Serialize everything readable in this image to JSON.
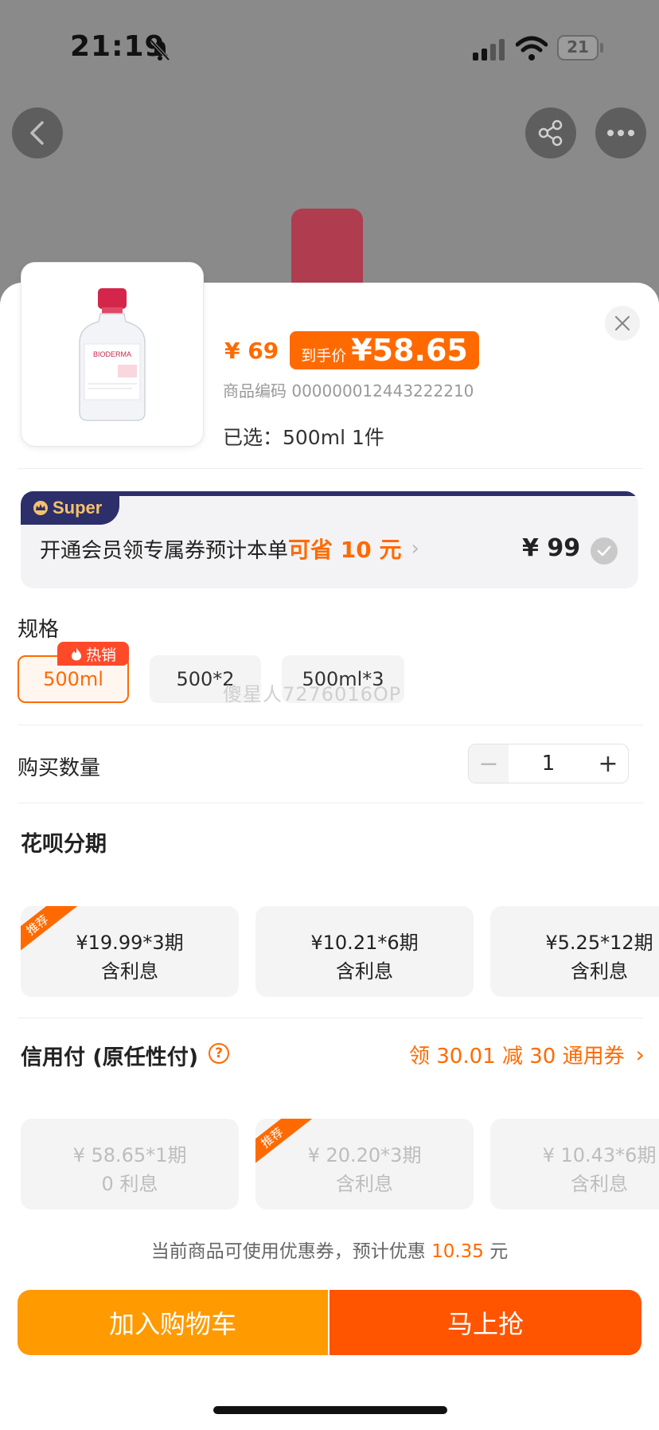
{
  "status_bar": {
    "time": "21:19",
    "battery": "21"
  },
  "product": {
    "brand_on_image": "BIODERMA",
    "price_original": "¥ 69",
    "price_final_label": "到手价",
    "price_final": "¥58.65",
    "code": "商品编码 000000012443222210",
    "selected": "已选：500ml  1件"
  },
  "super_banner": {
    "tag": "Super",
    "text": "开通会员领专属券预计本单",
    "save": "可省 10 元",
    "chevron": "›",
    "price": "¥ 99"
  },
  "spec": {
    "label": "规格",
    "hot_badge": "热销",
    "options": [
      {
        "label": "500ml",
        "selected": true
      },
      {
        "label": "500*2",
        "selected": false
      },
      {
        "label": "500ml*3",
        "selected": false
      }
    ],
    "watermark": "傻星人7276016OP"
  },
  "quantity": {
    "label": "购买数量",
    "value": "1",
    "minus": "−",
    "plus": "+"
  },
  "huabei": {
    "title": "花呗分期",
    "plans": [
      {
        "line1": "¥19.99*3期",
        "line2": "含利息",
        "badge": "推荐"
      },
      {
        "line1": "¥10.21*6期",
        "line2": "含利息"
      },
      {
        "line1": "¥5.25*12期",
        "line2": "含利息"
      }
    ]
  },
  "credit": {
    "title": "信用付 (原任性付)",
    "help": "?",
    "coupon": "领 30.01 减 30 通用券",
    "coupon_chevron": "›",
    "plans": [
      {
        "line1": "¥ 58.65*1期",
        "line2": "0 利息"
      },
      {
        "line1": "¥ 20.20*3期",
        "line2": "含利息",
        "badge": "推荐"
      },
      {
        "line1": "¥ 10.43*6期",
        "line2": "含利息"
      }
    ]
  },
  "discount_note": {
    "prefix": "当前商品可使用优惠券，预计优惠 ",
    "amount": "10.35",
    "suffix": " 元"
  },
  "actions": {
    "cart": "加入购物车",
    "buy": "马上抢"
  },
  "colors": {
    "accent": "#ff6a00",
    "buy": "#ff5500",
    "cart": "#ff9a00",
    "super_navy": "#2c2f6a"
  }
}
